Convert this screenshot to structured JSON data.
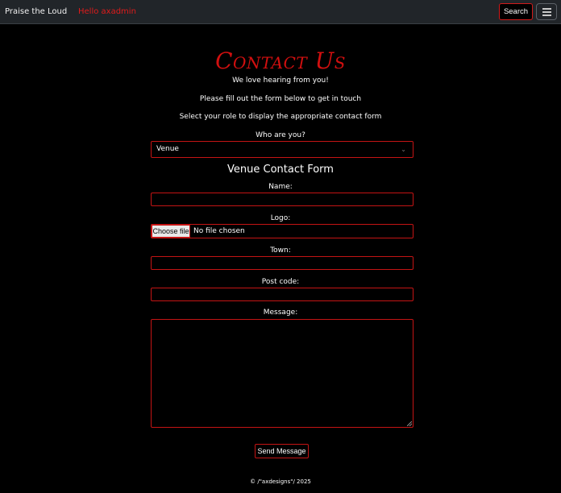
{
  "nav": {
    "brand": "Praise the Loud",
    "greeting": "Hello axadmin",
    "search_label": "Search",
    "menu_icon": "hamburger-menu-icon"
  },
  "page": {
    "title": "Contact Us",
    "subtitle": "We love hearing from you!",
    "instruction": "Please fill out the form below to get in touch",
    "role_instruction": "Select your role to display the appropriate contact form",
    "role_label": "Who are you?",
    "role_value": "Venue"
  },
  "form": {
    "title": "Venue Contact Form",
    "name_label": "Name:",
    "name_value": "",
    "logo_label": "Logo:",
    "file_button": "Choose file",
    "file_status": "No file chosen",
    "town_label": "Town:",
    "town_value": "",
    "postcode_label": "Post code:",
    "postcode_value": "",
    "message_label": "Message:",
    "message_value": "",
    "submit_label": "Send Message"
  },
  "footer": {
    "copyright": "© /\"axdesigns\"/ 2025"
  },
  "colors": {
    "accent": "#d10f0f",
    "background": "#000000",
    "navbar": "#212529"
  }
}
